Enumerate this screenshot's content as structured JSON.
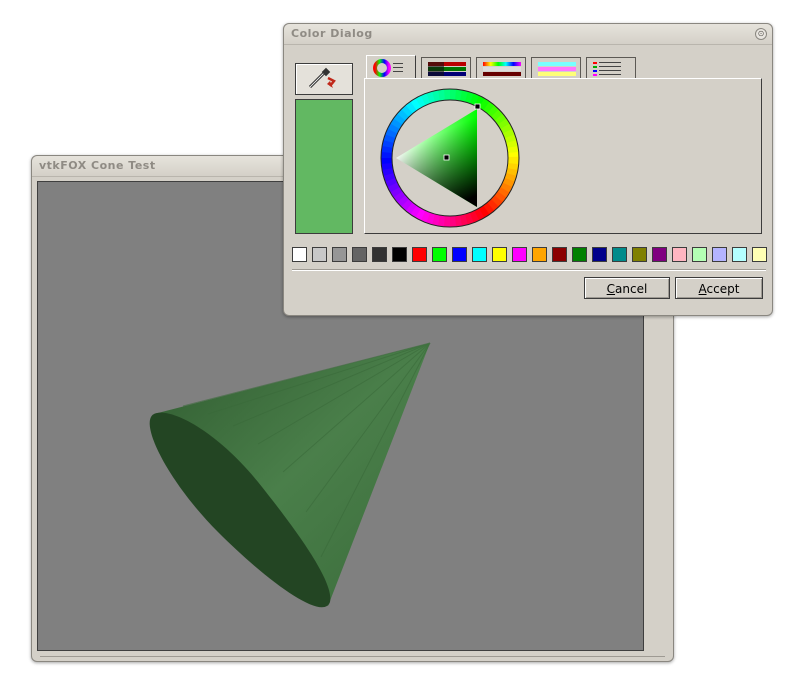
{
  "main_window": {
    "title": "vtkFOX Cone Test",
    "background_color": "#808080",
    "cone_color": "#3c6e3c"
  },
  "color_dialog": {
    "title": "Color Dialog",
    "close_glyph": "⊙",
    "current_color": "#62b862",
    "eyedropper_icon": "eyedropper-icon",
    "tabs": [
      {
        "name": "color-wheel-tab",
        "active": true
      },
      {
        "name": "rgb-sliders-tab",
        "active": false
      },
      {
        "name": "hsv-sliders-tab",
        "active": false
      },
      {
        "name": "cmy-sliders-tab",
        "active": false
      },
      {
        "name": "color-list-tab",
        "active": false
      }
    ],
    "swatches": [
      "#ffffff",
      "#c8c8c8",
      "#969696",
      "#646464",
      "#323232",
      "#000000",
      "#ff0000",
      "#00ff00",
      "#0000ff",
      "#00ffff",
      "#ffff00",
      "#ff00ff",
      "#ffa500",
      "#8b0000",
      "#008000",
      "#00008b",
      "#008b8b",
      "#808000",
      "#800080",
      "#ffb6c1",
      "#b4ffb4",
      "#b4b4ff",
      "#b4ffff",
      "#ffffb4"
    ],
    "cancel_label_pre": "",
    "cancel_label_key": "C",
    "cancel_label_post": "ancel",
    "accept_label_pre": "",
    "accept_label_key": "A",
    "accept_label_post": "ccept"
  }
}
